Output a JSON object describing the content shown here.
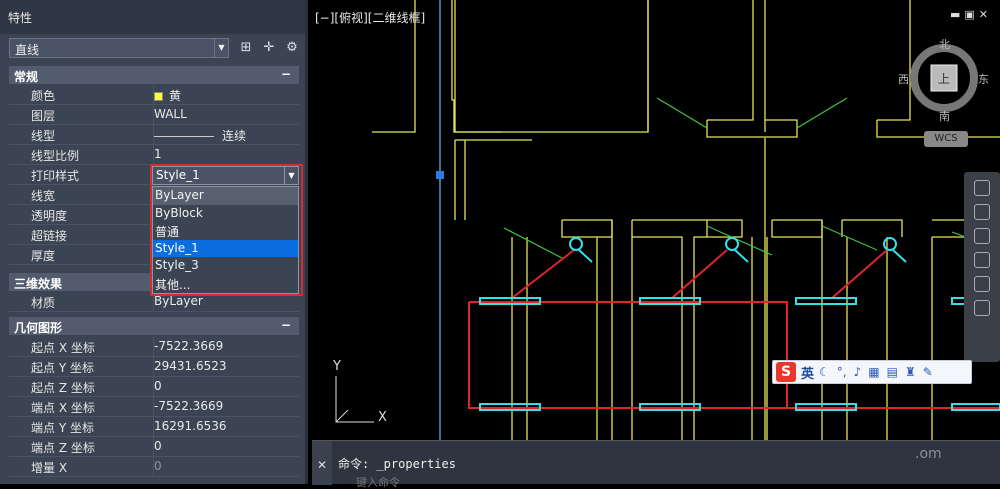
{
  "panel": {
    "title": "特性",
    "object_select": "直线",
    "sections": {
      "general": "常规",
      "threed": "三维效果",
      "geometry": "几何图形"
    },
    "general_rows": [
      {
        "label": "颜色",
        "value": "黄"
      },
      {
        "label": "图层",
        "value": "WALL"
      },
      {
        "label": "线型",
        "value": "连续"
      },
      {
        "label": "线型比例",
        "value": "1"
      },
      {
        "label": "打印样式",
        "value": "Style_1"
      },
      {
        "label": "线宽",
        "value": ""
      },
      {
        "label": "透明度",
        "value": ""
      },
      {
        "label": "超链接",
        "value": ""
      },
      {
        "label": "厚度",
        "value": ""
      }
    ],
    "threed_rows": [
      {
        "label": "材质",
        "value": "ByLayer"
      }
    ],
    "geometry_rows": [
      {
        "label": "起点 X 坐标",
        "value": "-7522.3669"
      },
      {
        "label": "起点 Y 坐标",
        "value": "29431.6523"
      },
      {
        "label": "起点 Z 坐标",
        "value": "0"
      },
      {
        "label": "端点 X 坐标",
        "value": "-7522.3669"
      },
      {
        "label": "端点 Y 坐标",
        "value": "16291.6536"
      },
      {
        "label": "端点 Z 坐标",
        "value": "0"
      },
      {
        "label": "增量 X",
        "value": "0"
      }
    ],
    "collapse_symbol": "−",
    "plot_style_options": [
      "ByLayer",
      "ByBlock",
      "普通",
      "Style_1",
      "Style_3",
      "其他..."
    ],
    "plot_style_selected": "Style_1"
  },
  "viewport": {
    "label": "[−][俯视][二维线框]",
    "viewcube": {
      "north": "北",
      "south": "南",
      "east": "东",
      "west": "西",
      "top": "上",
      "wcs": "WCS"
    },
    "ucs": {
      "x": "X",
      "y": "Y"
    },
    "colors": {
      "wall": "#e6e35a",
      "door": "#3ec43e",
      "red": "#e0242a",
      "window": "#33e0e8",
      "axis": "#4a9ad8"
    }
  },
  "ime": {
    "logo": "S",
    "mode": "英"
  },
  "command": {
    "history": "命令: _properties",
    "placeholder": "键入命令",
    "close": "✕"
  },
  "watermark": ".om"
}
